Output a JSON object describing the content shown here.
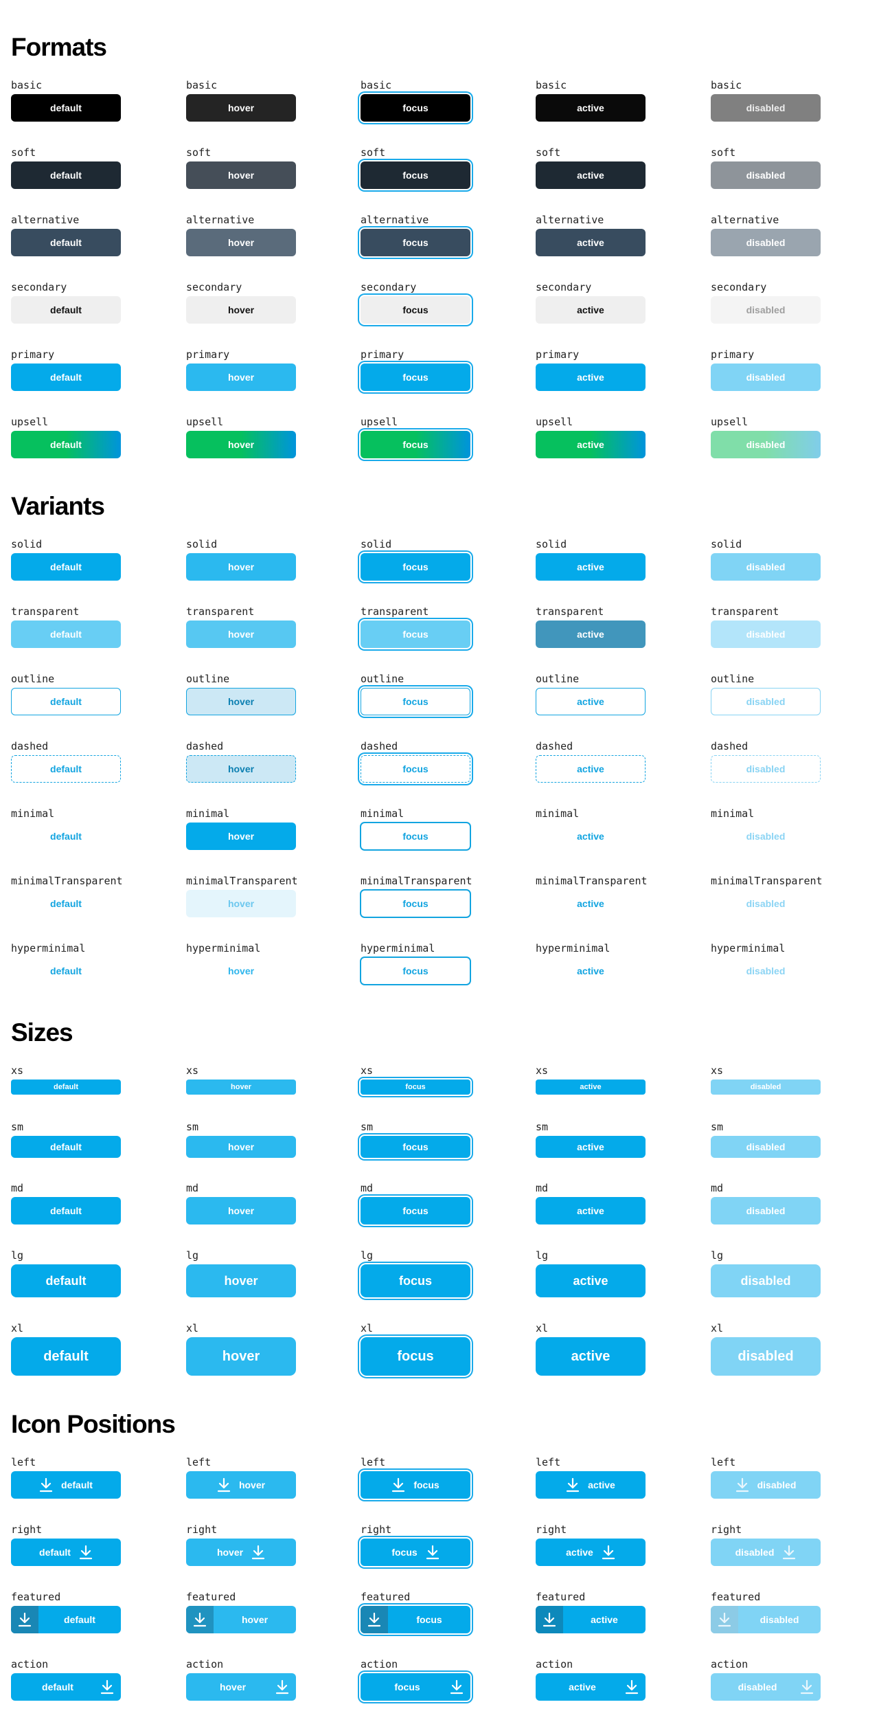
{
  "states": [
    "default",
    "hover",
    "focus",
    "active",
    "disabled"
  ],
  "sections": [
    {
      "title": "Formats",
      "kind": "format",
      "rows": [
        {
          "label": "basic",
          "key": "basic",
          "size": "md"
        },
        {
          "label": "soft",
          "key": "soft",
          "size": "md"
        },
        {
          "label": "alternative",
          "key": "alternative",
          "size": "md"
        },
        {
          "label": "secondary",
          "key": "secondary",
          "size": "md"
        },
        {
          "label": "primary",
          "key": "primary",
          "size": "md"
        },
        {
          "label": "upsell",
          "key": "upsell",
          "size": "md"
        }
      ]
    },
    {
      "title": "Variants",
      "kind": "variant",
      "rows": [
        {
          "label": "solid",
          "key": "solid",
          "size": "md"
        },
        {
          "label": "transparent",
          "key": "transparent",
          "size": "md"
        },
        {
          "label": "outline",
          "key": "outline",
          "size": "md"
        },
        {
          "label": "dashed",
          "key": "dashed",
          "size": "md"
        },
        {
          "label": "minimal",
          "key": "minimal",
          "size": "md"
        },
        {
          "label": "minimalTransparent",
          "key": "minimalTransparent",
          "size": "md"
        },
        {
          "label": "hyperminimal",
          "key": "hyperminimal",
          "size": "md"
        }
      ]
    },
    {
      "title": "Sizes",
      "kind": "size",
      "rows": [
        {
          "label": "xs",
          "key": "xs",
          "size": "xs"
        },
        {
          "label": "sm",
          "key": "sm",
          "size": "sm"
        },
        {
          "label": "md",
          "key": "md",
          "size": "md"
        },
        {
          "label": "lg",
          "key": "lg",
          "size": "lg"
        },
        {
          "label": "xl",
          "key": "xl",
          "size": "xl"
        }
      ]
    },
    {
      "title": "Icon Positions",
      "kind": "icon",
      "rows": [
        {
          "label": "left",
          "key": "left",
          "size": "md",
          "icon": "download-icon"
        },
        {
          "label": "right",
          "key": "right",
          "size": "md",
          "icon": "download-icon"
        },
        {
          "label": "featured",
          "key": "featured",
          "size": "md",
          "icon": "download-icon"
        },
        {
          "label": "action",
          "key": "action",
          "size": "md",
          "icon": "download-icon"
        }
      ]
    }
  ],
  "colors": {
    "primary": "#04aaea",
    "focus_ring": "#19aaea",
    "upsell_start": "#06c05e",
    "upsell_end": "#0094dc",
    "basic": "#000000",
    "soft": "#1e2933",
    "alternative": "#384c5f",
    "secondary": "#efefef"
  }
}
